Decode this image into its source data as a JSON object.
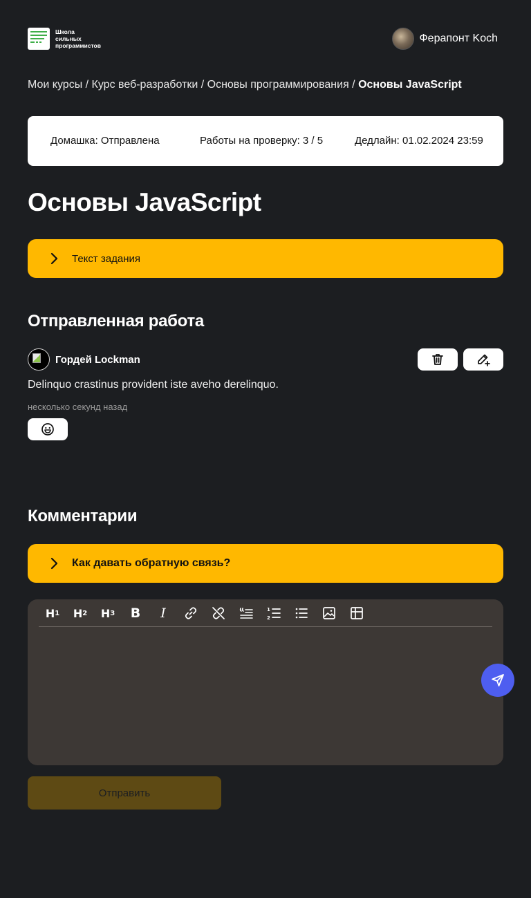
{
  "header": {
    "logo_lines": [
      "Школа",
      "сильных",
      "программистов"
    ],
    "user_name": "Ферапонт Koch"
  },
  "breadcrumb": {
    "items": [
      "Мои курсы",
      "Курс веб-разработки",
      "Основы программирования"
    ],
    "separator": " / ",
    "current": "Основы JavaScript"
  },
  "status": {
    "homework": "Домашка: Отправлена",
    "review": "Работы на проверку: 3 / 5",
    "deadline": "Дедлайн: 01.02.2024 23:59"
  },
  "page_title": "Основы JavaScript",
  "task_accordion": {
    "label": "Текст задания"
  },
  "submission": {
    "title": "Отправленная работа",
    "author": "Гордей Lockman",
    "text": "Delinquo crastinus provident iste aveho derelinquo.",
    "time": "несколько секунд назад",
    "actions": [
      "trash-icon",
      "edit-add-icon"
    ],
    "reaction_icon": "emoji-icon"
  },
  "comments": {
    "title": "Комментарии",
    "feedback_accordion": "Как давать обратную связь?",
    "toolbar": [
      "H1",
      "H2",
      "H3",
      "B",
      "I",
      "link",
      "unlink",
      "quote",
      "ordered-list",
      "bullet-list",
      "image",
      "table"
    ],
    "submit_label": "Отправить"
  },
  "colors": {
    "background": "#1c1e21",
    "accent": "#ffb800",
    "editor_bg": "#3d3835",
    "fab": "#4e5ef0",
    "submit_disabled": "#5e4a14"
  }
}
